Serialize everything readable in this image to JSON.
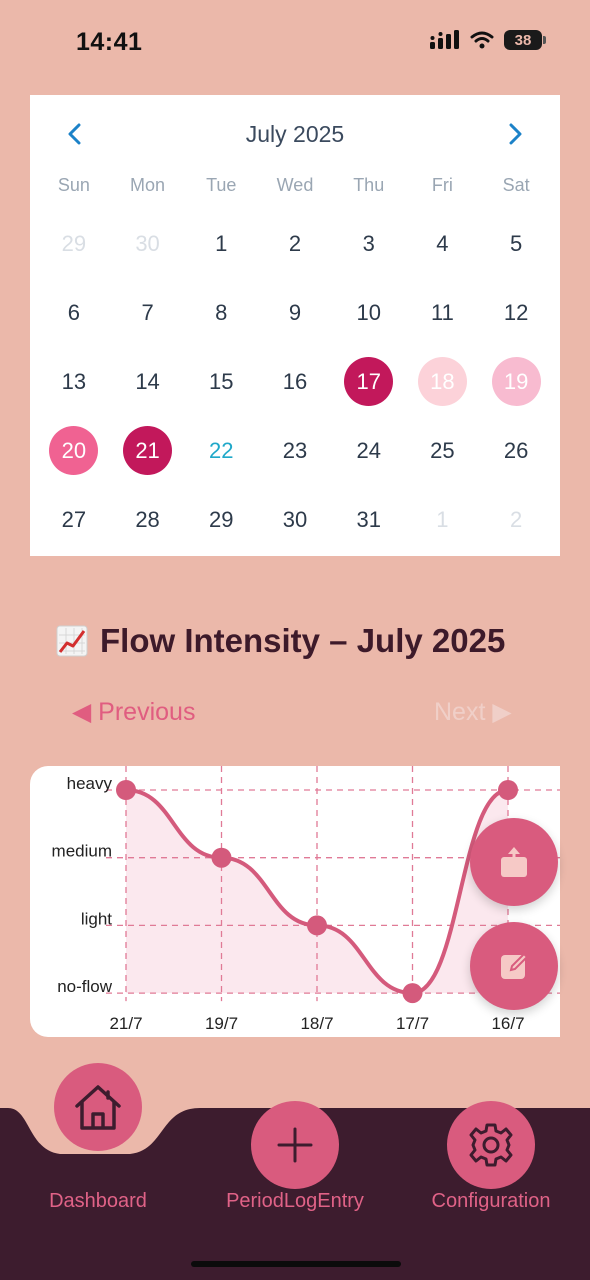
{
  "status_bar": {
    "time": "14:41",
    "battery": "38"
  },
  "calendar": {
    "title": "July 2025",
    "weekdays": [
      "Sun",
      "Mon",
      "Tue",
      "Wed",
      "Thu",
      "Fri",
      "Sat"
    ],
    "days": [
      {
        "d": "29",
        "muted": true
      },
      {
        "d": "30",
        "muted": true
      },
      {
        "d": "1"
      },
      {
        "d": "2"
      },
      {
        "d": "3"
      },
      {
        "d": "4"
      },
      {
        "d": "5"
      },
      {
        "d": "6"
      },
      {
        "d": "7"
      },
      {
        "d": "8"
      },
      {
        "d": "9"
      },
      {
        "d": "10"
      },
      {
        "d": "11"
      },
      {
        "d": "12"
      },
      {
        "d": "13"
      },
      {
        "d": "14"
      },
      {
        "d": "15"
      },
      {
        "d": "16"
      },
      {
        "d": "17",
        "flow": "heavy"
      },
      {
        "d": "18",
        "flow": "spot"
      },
      {
        "d": "19",
        "flow": "light"
      },
      {
        "d": "20",
        "flow": "medium"
      },
      {
        "d": "21",
        "flow": "heavy"
      },
      {
        "d": "22",
        "today": true
      },
      {
        "d": "23"
      },
      {
        "d": "24"
      },
      {
        "d": "25"
      },
      {
        "d": "26"
      },
      {
        "d": "27"
      },
      {
        "d": "28"
      },
      {
        "d": "29"
      },
      {
        "d": "30"
      },
      {
        "d": "31"
      },
      {
        "d": "1",
        "muted": true
      },
      {
        "d": "2",
        "muted": true
      }
    ],
    "colors": {
      "heavy": "#c2185b",
      "medium": "#f06292",
      "light": "#f8bbd0",
      "spot": "#fcd2d9",
      "today": "#1fa8c9"
    }
  },
  "chart_section": {
    "emoji": "📈",
    "title": "Flow Intensity – July 2025",
    "previous_label": "◀ Previous",
    "next_label": "Next ▶"
  },
  "chart_data": {
    "type": "line",
    "title": "Flow Intensity – July 2025",
    "categories": [
      "21/7",
      "19/7",
      "18/7",
      "17/7",
      "16/7"
    ],
    "y_levels": [
      "no-flow",
      "light",
      "medium",
      "heavy"
    ],
    "values": [
      "heavy",
      "medium",
      "light",
      "no-flow",
      "heavy"
    ],
    "grid": true,
    "line_color": "#d45a7c",
    "fill_color": "#fbe8ee"
  },
  "fabs": {
    "share": "share-icon",
    "edit": "edit-icon"
  },
  "bottom_nav": {
    "items": [
      {
        "label": "Dashboard",
        "icon": "home-icon",
        "active": true
      },
      {
        "label": "PeriodLogEntry",
        "icon": "plus-icon",
        "active": false
      },
      {
        "label": "Configuration",
        "icon": "gear-icon",
        "active": false
      }
    ],
    "bar_color": "#3d1c2e",
    "button_color": "#d95b7e"
  }
}
